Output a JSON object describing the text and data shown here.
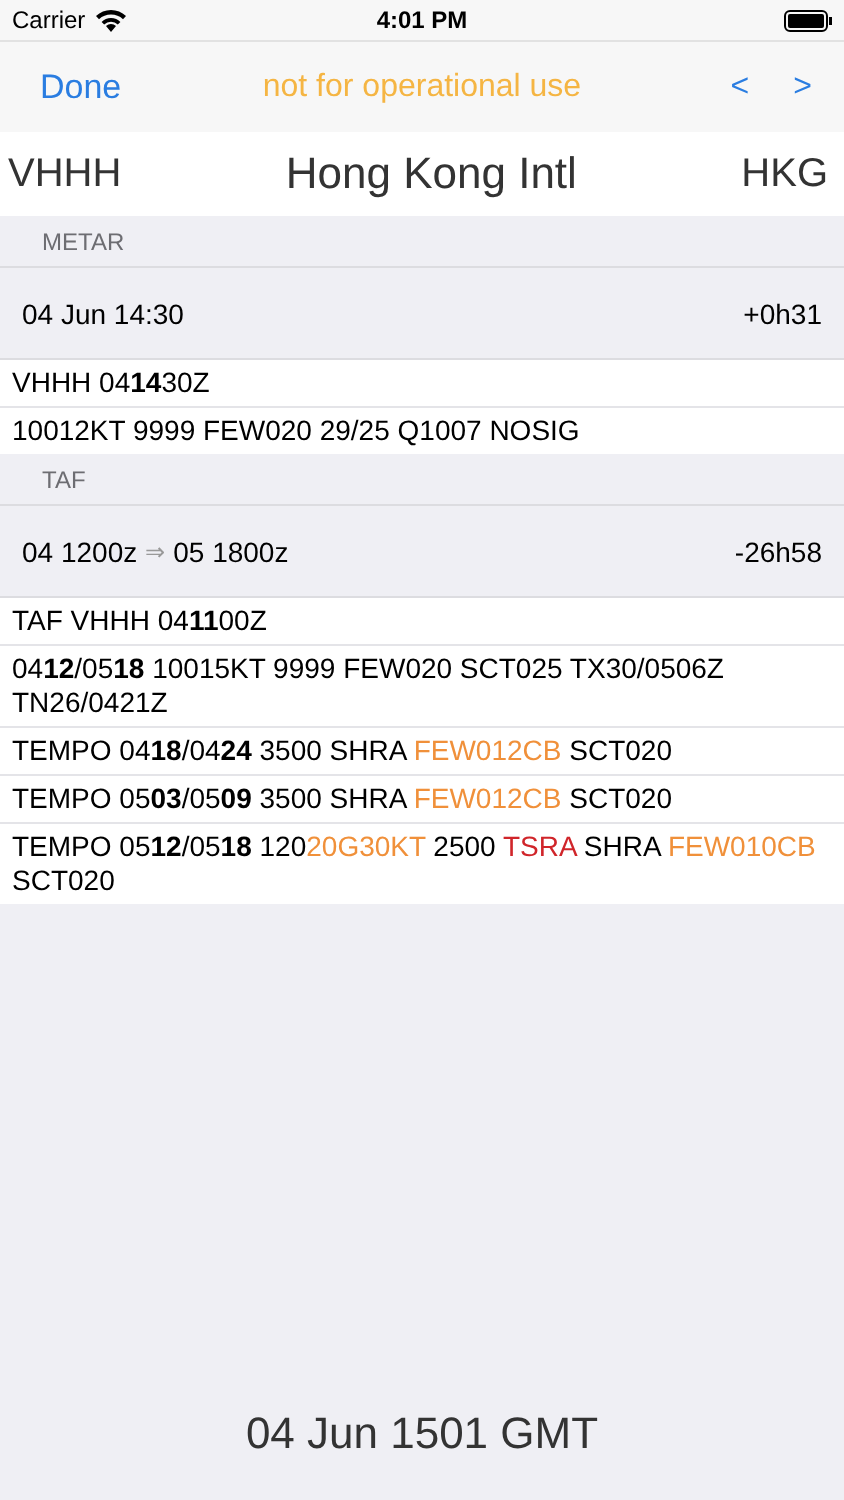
{
  "status_bar": {
    "carrier": "Carrier",
    "time": "4:01 PM"
  },
  "nav": {
    "done": "Done",
    "notice": "not for operational use",
    "prev": "<",
    "next": ">"
  },
  "station": {
    "icao": "VHHH",
    "name": "Hong Kong Intl",
    "iata": "HKG"
  },
  "sections": [
    {
      "title": "METAR",
      "time": "04 Jun 14:30",
      "age": "+0h31",
      "lines": [
        [
          {
            "text": "VHHH 04**14**30Z"
          }
        ],
        [
          {
            "text": "10012KT 9999 FEW020 29/25 Q1007 NOSIG"
          }
        ]
      ]
    },
    {
      "title": "TAF",
      "time": "04 1200z",
      "arrow": "⇒",
      "time_end": "05 1800z",
      "age": "-26h58",
      "lines": [
        [
          {
            "text": "TAF VHHH 04**11**00Z"
          }
        ],
        [
          {
            "text": "04**12**/05**18** 10015KT 9999 FEW020 SCT025 TX30/0506Z TN26/0421Z"
          }
        ],
        [
          {
            "text": "TEMPO 04**18**/04**24** 3500 SHRA "
          },
          {
            "text": "FEW012CB",
            "color": "#f0903a"
          },
          {
            "text": " SCT020"
          }
        ],
        [
          {
            "text": "TEMPO 05**03**/05**09** 3500 SHRA "
          },
          {
            "text": "FEW012CB",
            "color": "#f0903a"
          },
          {
            "text": " SCT020"
          }
        ],
        [
          {
            "text": "TEMPO 05**12**/05**18** 120"
          },
          {
            "text": "20G30KT",
            "color": "#f0903a"
          },
          {
            "text": " 2500 "
          },
          {
            "text": "TSRA",
            "color": "#d0252a"
          },
          {
            "text": " SHRA "
          },
          {
            "text": "FEW010CB",
            "color": "#f0903a"
          },
          {
            "text": " SCT020"
          }
        ]
      ]
    }
  ],
  "footer": "04 Jun 1501 GMT"
}
